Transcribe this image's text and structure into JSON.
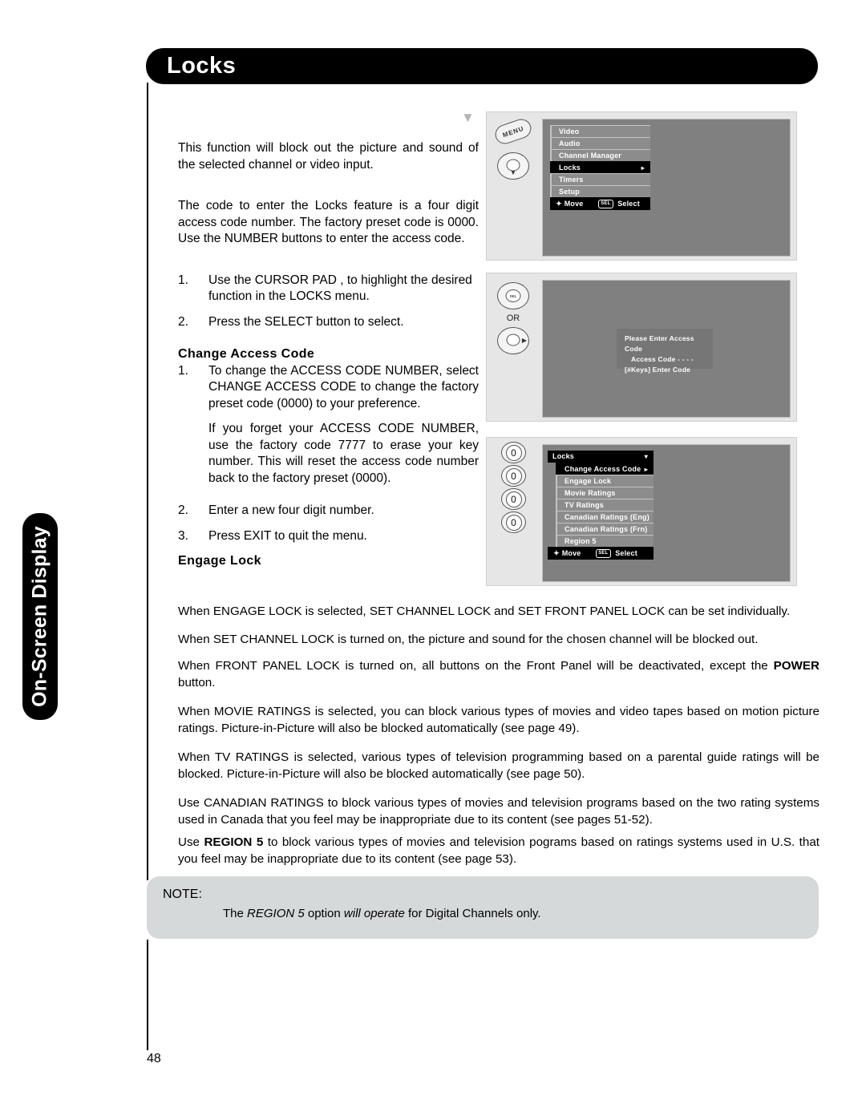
{
  "page": {
    "title": "Locks",
    "side_tab": "On-Screen Display",
    "page_number": "48"
  },
  "body": {
    "intro1": "This function will block out the picture and sound of the selected channel or video input.",
    "intro2": "The code to enter the Locks feature is a four digit access code number. The factory preset code is 0000. Use the NUMBER buttons to enter the access code.",
    "step1_num": "1.",
    "step1_text": "Use the CURSOR PAD  ,  to highlight the desired function in the LOCKS menu.",
    "step2_num": "2.",
    "step2_text": "Press the SELECT button to select.",
    "change_access_code_head": "Change Access Code",
    "cac1_num": "1.",
    "cac1_text": "To change the ACCESS CODE NUMBER, select CHANGE ACCESS CODE to change the factory preset code (0000) to your preference.",
    "cac1_sub": "If you forget your ACCESS CODE NUMBER, use the factory code 7777 to erase your key number. This will reset the access code number back to the factory preset (0000).",
    "cac2_num": "2.",
    "cac2_text": "Enter a new four digit number.",
    "cac3_num": "3.",
    "cac3_text": "Press EXIT to quit the menu.",
    "engage_lock_head": "Engage Lock",
    "wide1": "When ENGAGE LOCK is selected, SET CHANNEL LOCK and SET FRONT PANEL LOCK can be set individually.",
    "wide2": "When SET CHANNEL LOCK is turned on, the picture and sound for the chosen channel will be blocked out.",
    "wide3_a": "When FRONT PANEL LOCK is turned on, all buttons on the Front Panel will be deactivated, except the ",
    "wide3_bold": "POWER",
    "wide3_b": " button.",
    "wide4": "When MOVIE RATINGS is selected, you can block various types of movies and video tapes based on motion picture ratings. Picture-in-Picture will also be blocked automatically (see page 49).",
    "wide5": "When TV RATINGS is selected, various types of television programming based on a parental guide ratings will be blocked. Picture-in-Picture will also be blocked automatically (see page 50).",
    "wide6": "Use CANADIAN RATINGS to block various types of movies and television programs based on the two rating systems used in Canada that you feel may be inappropriate due to its content (see pages 51-52).",
    "wide7_a": "Use ",
    "wide7_bold": "REGION 5",
    "wide7_b": " to block various types of movies and television pograms based on ratings systems used in U.S. that you feel may be inappropriate due to its content (see page 53)."
  },
  "note": {
    "label": "NOTE:",
    "text_a": "The ",
    "text_italic1": "REGION 5",
    "text_b": " option ",
    "text_italic2": "will operate",
    "text_c": " for Digital Channels only."
  },
  "figures": {
    "fig1": {
      "menu_items": [
        {
          "label": "Video",
          "selected": false,
          "caret": ""
        },
        {
          "label": "Audio",
          "selected": false,
          "caret": ""
        },
        {
          "label": "Channel Manager",
          "selected": false,
          "caret": ""
        },
        {
          "label": "Locks",
          "selected": true,
          "caret": "▸"
        },
        {
          "label": "Timers",
          "selected": false,
          "caret": ""
        },
        {
          "label": "Setup",
          "selected": false,
          "caret": ""
        }
      ],
      "footer_move": "Move",
      "footer_sel_key": "SEL",
      "footer_select": "Select",
      "menu_button_label": "MENU"
    },
    "fig2": {
      "sel_button_label": "SEL",
      "or_label": "OR",
      "dialog_line1": "Please Enter Access Code",
      "dialog_line2": "Access Code  - - - -",
      "dialog_line3": "[#Keys] Enter Code"
    },
    "fig3": {
      "header": "Locks",
      "header_caret": "▾",
      "menu_items": [
        {
          "label": "Change Access Code",
          "selected": true,
          "caret": "▸"
        },
        {
          "label": "Engage Lock",
          "selected": false,
          "caret": ""
        },
        {
          "label": "Movie Ratings",
          "selected": false,
          "caret": ""
        },
        {
          "label": "TV Ratings",
          "selected": false,
          "caret": ""
        },
        {
          "label": "Canadian Ratings (Eng)",
          "selected": false,
          "caret": ""
        },
        {
          "label": "Canadian Ratings (Frn)",
          "selected": false,
          "caret": ""
        },
        {
          "label": "Region 5",
          "selected": false,
          "caret": ""
        }
      ],
      "footer_move": "Move",
      "footer_sel_key": "SEL",
      "footer_select": "Select",
      "number_buttons": [
        "0",
        "0",
        "0",
        "0"
      ]
    }
  },
  "colors": {
    "header_bar": "#000000",
    "osd_screen": "#808080",
    "osd_row": "#8c8c8c",
    "note_bg": "#d5d9d9"
  }
}
